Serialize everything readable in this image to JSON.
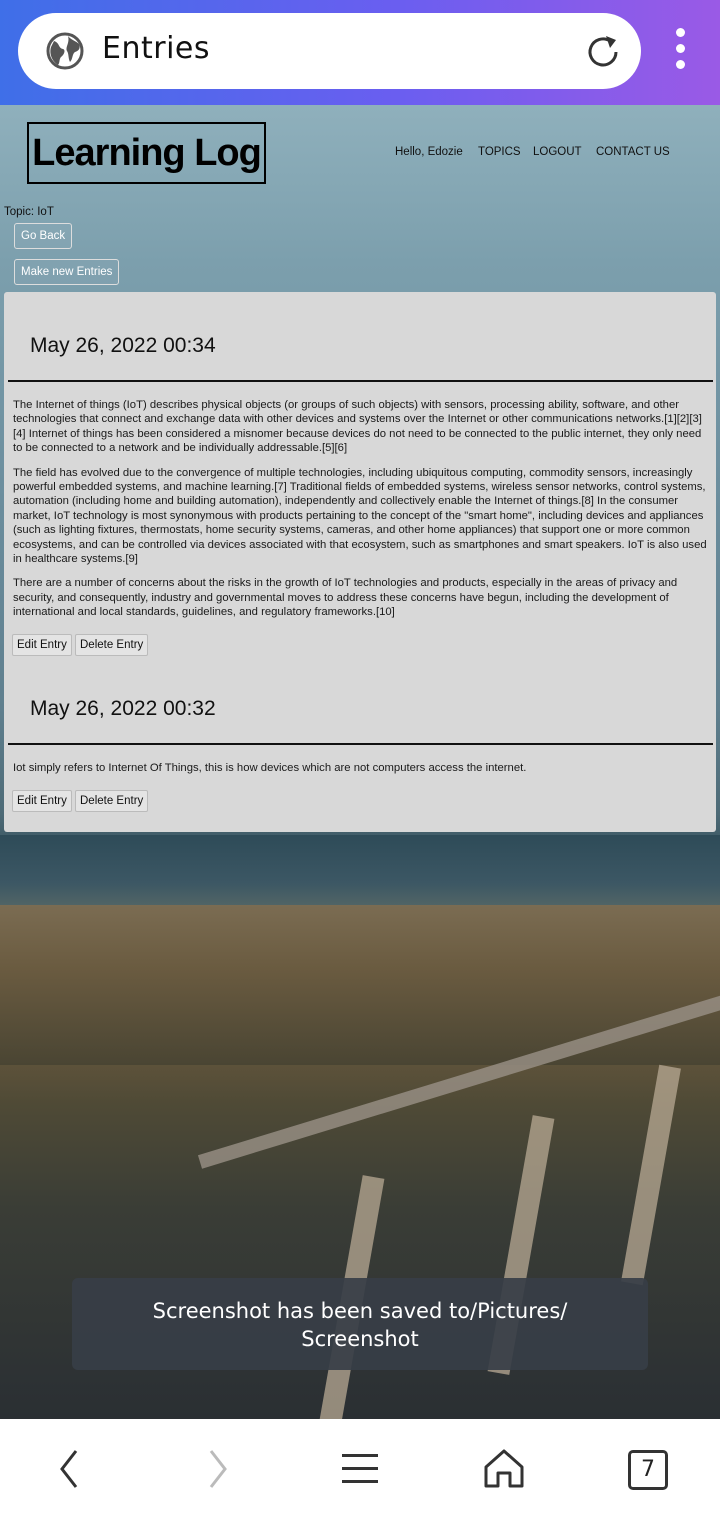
{
  "browser": {
    "page_title": "Entries",
    "tab_count": "7",
    "icons": {
      "globe": "globe-icon",
      "reload": "reload-icon",
      "menu": "more-vertical-icon",
      "back": "back-arrow-icon",
      "forward": "forward-arrow-icon",
      "hamburger": "menu-icon",
      "home": "home-icon",
      "tabs": "tabs-icon"
    }
  },
  "site": {
    "brand": "Learning Log",
    "nav": {
      "greeting": "Hello, Edozie",
      "topics": "TOPICS",
      "logout": "LOGOUT",
      "contact": "CONTACT US"
    }
  },
  "topic": {
    "label": "Topic: IoT",
    "go_back": "Go Back",
    "new_entry": "Make new Entries"
  },
  "entries": [
    {
      "date": "May 26, 2022 00:34",
      "paragraphs": [
        "The Internet of things (IoT) describes physical objects (or groups of such objects) with sensors, processing ability, software, and other technologies that connect and exchange data with other devices and systems over the Internet or other communications networks.[1][2][3][4] Internet of things has been considered a misnomer because devices do not need to be connected to the public internet, they only need to be connected to a network and be individually addressable.[5][6]",
        "The field has evolved due to the convergence of multiple technologies, including ubiquitous computing, commodity sensors, increasingly powerful embedded systems, and machine learning.[7] Traditional fields of embedded systems, wireless sensor networks, control systems, automation (including home and building automation), independently and collectively enable the Internet of things.[8] In the consumer market, IoT technology is most synonymous with products pertaining to the concept of the \"smart home\", including devices and appliances (such as lighting fixtures, thermostats, home security systems, cameras, and other home appliances) that support one or more common ecosystems, and can be controlled via devices associated with that ecosystem, such as smartphones and smart speakers. IoT is also used in healthcare systems.[9]",
        "There are a number of concerns about the risks in the growth of IoT technologies and products, especially in the areas of privacy and security, and consequently, industry and governmental moves to address these concerns have begun, including the development of international and local standards, guidelines, and regulatory frameworks.[10]"
      ],
      "edit": "Edit Entry",
      "delete": "Delete Entry"
    },
    {
      "date": "May 26, 2022 00:32",
      "paragraphs": [
        "Iot simply refers to Internet Of Things, this is how devices which are not computers access the internet."
      ],
      "edit": "Edit Entry",
      "delete": "Delete Entry"
    }
  ],
  "toast": {
    "line1": "Screenshot has been saved to/Pictures/",
    "line2": "Screenshot"
  }
}
